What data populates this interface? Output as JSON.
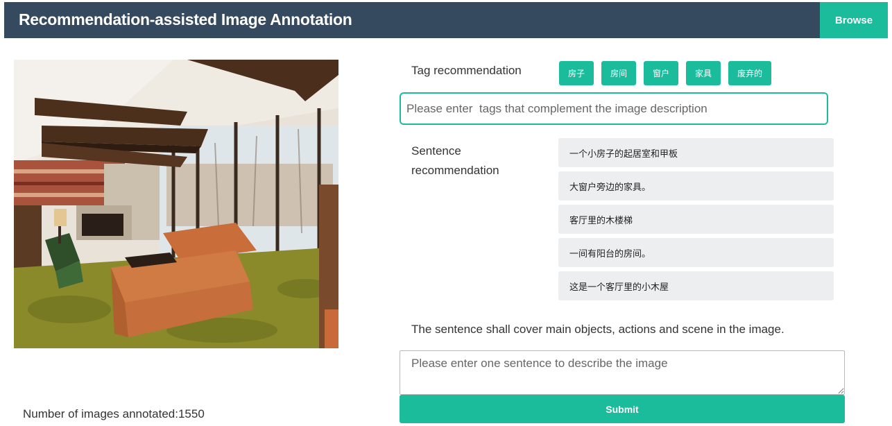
{
  "header": {
    "title": "Recommendation-assisted Image Annotation",
    "browse_label": "Browse"
  },
  "tag_section": {
    "label": "Tag recommendation",
    "tags": [
      "房子",
      "房间",
      "窗户",
      "家具",
      "废弃的"
    ],
    "input_placeholder": "Please enter  tags that complement the image description"
  },
  "sentence_section": {
    "label": "Sentence recommendation",
    "sentences": [
      "一个小房子的起居室和甲板",
      "大窗户旁边的家具。",
      "客厅里的木楼梯",
      "一间有阳台的房间。",
      "这是一个客厅里的小木屋"
    ]
  },
  "instruction": "The sentence shall cover main objects, actions and scene in the image.",
  "description_input": {
    "placeholder": "Please enter one sentence to describe the image"
  },
  "submit_label": "Submit",
  "footer": {
    "count_text": "Number of images annotated:1550"
  },
  "colors": {
    "header_bg": "#354a5f",
    "accent": "#1abc9c",
    "sentence_bg": "#eceeef"
  }
}
